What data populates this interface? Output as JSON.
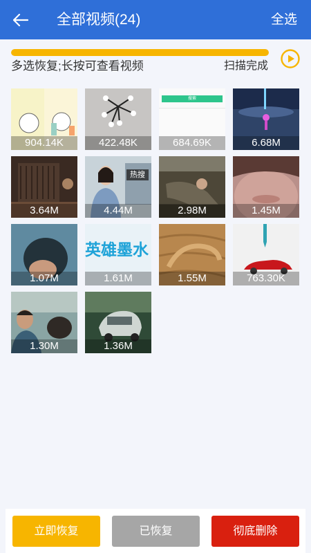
{
  "header": {
    "title": "全部视频(24)",
    "select_all_label": "全选"
  },
  "scan": {
    "hint": "多选恢复;长按可查看视频",
    "status": "扫描完成",
    "progress_percent": 100
  },
  "videos": [
    {
      "size": "904.14K"
    },
    {
      "size": "422.48K"
    },
    {
      "size": "684.69K"
    },
    {
      "size": "6.68M"
    },
    {
      "size": "3.64M"
    },
    {
      "size": "4.44M"
    },
    {
      "size": "2.98M"
    },
    {
      "size": "1.45M"
    },
    {
      "size": "1.07M"
    },
    {
      "size": "1.61M",
      "text_in_thumb": "英雄墨水"
    },
    {
      "size": "1.55M"
    },
    {
      "size": "763.30K"
    },
    {
      "size": "1.30M"
    },
    {
      "size": "1.36M"
    }
  ],
  "thumb_texts": {
    "news_tag": "热搜",
    "green_bar": "搜索"
  },
  "footer": {
    "recover_now_label": "立即恢复",
    "recovered_label": "已恢复",
    "delete_label": "彻底删除"
  },
  "colors": {
    "header_bg": "#2f6fd8",
    "progress": "#f7b500",
    "recover_btn": "#f7b500",
    "recovered_btn": "#a6a6a6",
    "delete_btn": "#d9200f"
  },
  "icons": {
    "back": "arrow-left-icon",
    "play": "play-circle-icon"
  }
}
